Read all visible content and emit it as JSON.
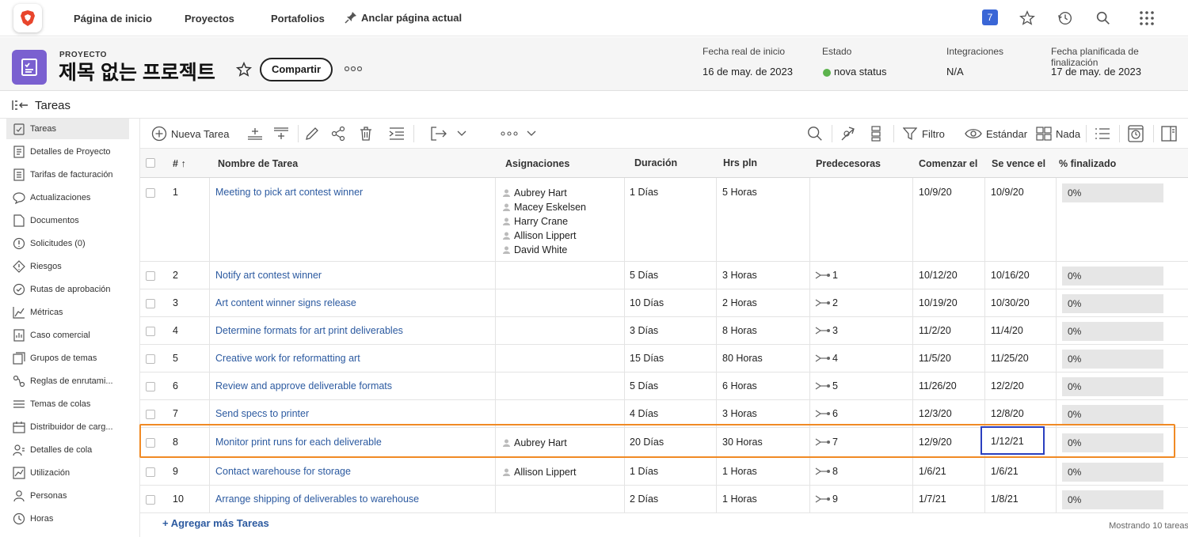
{
  "topnav": {
    "home": "Página de inicio",
    "projects": "Proyectos",
    "portfolios": "Portafolios",
    "pin": "Anclar página actual",
    "badge": "7"
  },
  "project": {
    "label": "PROYECTO",
    "title": "제목 없는 프로젝트",
    "share": "Compartir",
    "meta": [
      {
        "label": "Fecha real de inicio",
        "value": "16 de may. de 2023"
      },
      {
        "label": "Estado",
        "value": "nova status"
      },
      {
        "label": "Integraciones",
        "value": "N/A"
      },
      {
        "label": "Fecha planificada de finalización",
        "value": "17 de may. de 2023"
      }
    ],
    "status_color": "#5cb34d"
  },
  "section_title": "Tareas",
  "sidebar": [
    {
      "label": "Tareas",
      "icon": "tasks-icon"
    },
    {
      "label": "Detalles de Proyecto",
      "icon": "details-icon"
    },
    {
      "label": "Tarifas de facturación",
      "icon": "billing-icon"
    },
    {
      "label": "Actualizaciones",
      "icon": "updates-icon"
    },
    {
      "label": "Documentos",
      "icon": "documents-icon"
    },
    {
      "label": "Solicitudes (0)",
      "icon": "requests-icon"
    },
    {
      "label": "Riesgos",
      "icon": "risks-icon"
    },
    {
      "label": "Rutas de aprobación",
      "icon": "approval-icon"
    },
    {
      "label": "Métricas",
      "icon": "metrics-icon"
    },
    {
      "label": "Caso comercial",
      "icon": "business-case-icon"
    },
    {
      "label": "Grupos de temas",
      "icon": "topic-groups-icon"
    },
    {
      "label": "Reglas de enrutami...",
      "icon": "routing-icon"
    },
    {
      "label": "Temas de colas",
      "icon": "queue-topics-icon"
    },
    {
      "label": "Distribuidor de carg...",
      "icon": "workload-icon"
    },
    {
      "label": "Detalles de cola",
      "icon": "queue-details-icon"
    },
    {
      "label": "Utilización",
      "icon": "utilization-icon"
    },
    {
      "label": "Personas",
      "icon": "people-icon"
    },
    {
      "label": "Horas",
      "icon": "hours-icon"
    }
  ],
  "toolbar": {
    "new_task": "Nueva Tarea",
    "filter": "Filtro",
    "view": "Estándar",
    "grouping": "Nada"
  },
  "columns": {
    "num": "#",
    "name": "Nombre de Tarea",
    "assignments": "Asignaciones",
    "duration": "Duración",
    "planned_hours": "Hrs pln",
    "predecessors": "Predecesoras",
    "start": "Comenzar el",
    "due": "Se vence el",
    "pct": "% finalizado"
  },
  "rows": [
    {
      "num": "1",
      "name": "Meeting to pick art contest winner",
      "assignees": [
        "Aubrey Hart",
        "Macey Eskelsen",
        "Harry Crane",
        "Allison Lippert",
        "David White"
      ],
      "dur_n": "1",
      "dur_u": "Días",
      "hrs_n": "5",
      "hrs_u": "Horas",
      "pred": "",
      "start": "10/9/20",
      "due": "10/9/20",
      "pct": "0%"
    },
    {
      "num": "2",
      "name": "Notify art contest winner",
      "assignees": [],
      "dur_n": "5",
      "dur_u": "Días",
      "hrs_n": "3",
      "hrs_u": "Horas",
      "pred": "1",
      "start": "10/12/20",
      "due": "10/16/20",
      "pct": "0%"
    },
    {
      "num": "3",
      "name": "Art content winner signs release",
      "assignees": [],
      "dur_n": "10",
      "dur_u": "Días",
      "hrs_n": "2",
      "hrs_u": "Horas",
      "pred": "2",
      "start": "10/19/20",
      "due": "10/30/20",
      "pct": "0%"
    },
    {
      "num": "4",
      "name": "Determine formats for art print deliverables",
      "assignees": [],
      "dur_n": "3",
      "dur_u": "Días",
      "hrs_n": "8",
      "hrs_u": "Horas",
      "pred": "3",
      "start": "11/2/20",
      "due": "11/4/20",
      "pct": "0%"
    },
    {
      "num": "5",
      "name": "Creative work for reformatting art",
      "assignees": [],
      "dur_n": "15",
      "dur_u": "Días",
      "hrs_n": "80",
      "hrs_u": "Horas",
      "pred": "4",
      "start": "11/5/20",
      "due": "11/25/20",
      "pct": "0%"
    },
    {
      "num": "6",
      "name": "Review and approve deliverable formats",
      "assignees": [],
      "dur_n": "5",
      "dur_u": "Días",
      "hrs_n": "6",
      "hrs_u": "Horas",
      "pred": "5",
      "start": "11/26/20",
      "due": "12/2/20",
      "pct": "0%"
    },
    {
      "num": "7",
      "name": "Send specs to printer",
      "assignees": [],
      "dur_n": "4",
      "dur_u": "Días",
      "hrs_n": "3",
      "hrs_u": "Horas",
      "pred": "6",
      "start": "12/3/20",
      "due": "12/8/20",
      "pct": "0%"
    },
    {
      "num": "8",
      "name": "Monitor print runs for each deliverable",
      "assignees": [
        "Aubrey Hart"
      ],
      "dur_n": "20",
      "dur_u": "Días",
      "hrs_n": "30",
      "hrs_u": "Horas",
      "pred": "7",
      "start": "12/9/20",
      "due": "1/12/21",
      "pct": "0%"
    },
    {
      "num": "9",
      "name": "Contact warehouse for storage",
      "assignees": [
        "Allison Lippert"
      ],
      "dur_n": "1",
      "dur_u": "Días",
      "hrs_n": "1",
      "hrs_u": "Horas",
      "pred": "8",
      "start": "1/6/21",
      "due": "1/6/21",
      "pct": "0%"
    },
    {
      "num": "10",
      "name": "Arrange shipping of deliverables to warehouse",
      "assignees": [],
      "dur_n": "2",
      "dur_u": "Días",
      "hrs_n": "1",
      "hrs_u": "Horas",
      "pred": "9",
      "start": "1/7/21",
      "due": "1/8/21",
      "pct": "0%"
    }
  ],
  "footer": {
    "add_more": "+ Agregar más Tareas",
    "showing": "Mostrando 10 tareas"
  },
  "colors": {
    "accent": "#2c5aa0",
    "project_icon": "#7a60d0",
    "highlight_row": "#f08a24",
    "highlight_cell": "#2a3fbf"
  }
}
